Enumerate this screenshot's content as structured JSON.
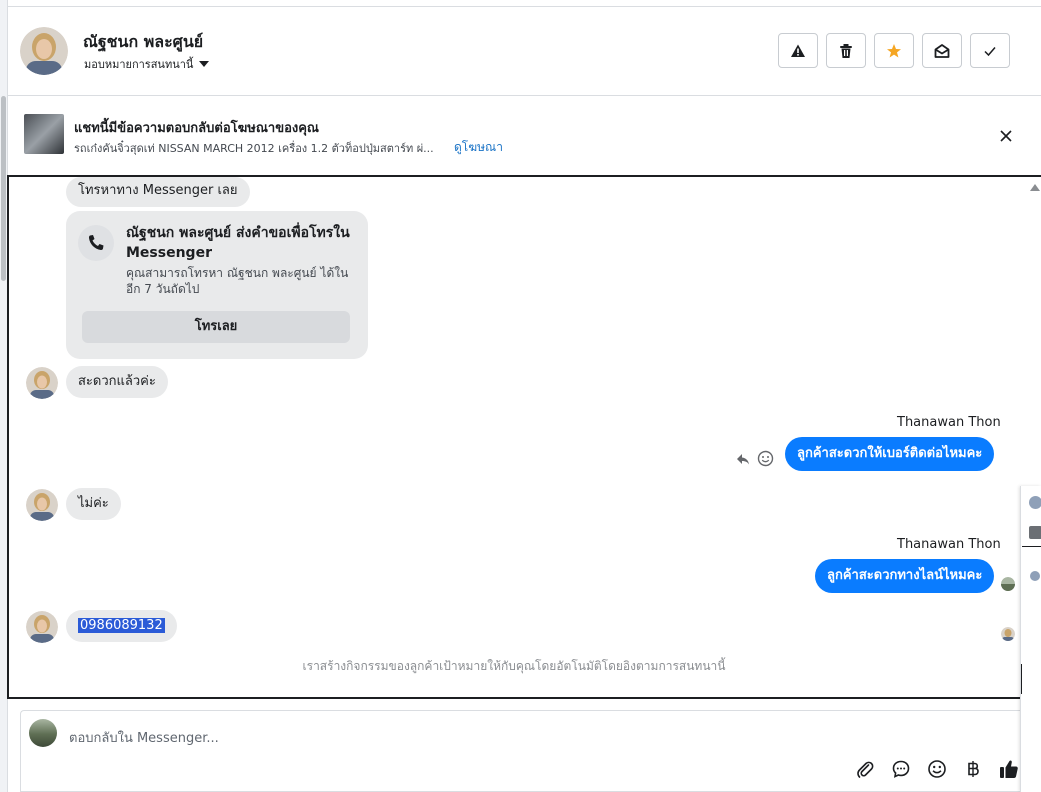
{
  "header": {
    "name": "ณัฐชนก พละศูนย์",
    "assign_label": "มอบหมายการสนทนานี้"
  },
  "actions": [
    {
      "name": "report-spam-button",
      "icon": "warning-icon"
    },
    {
      "name": "delete-button",
      "icon": "trash-icon"
    },
    {
      "name": "star-button",
      "icon": "star-icon",
      "color": "#f5a623"
    },
    {
      "name": "mark-unread-button",
      "icon": "envelope-open-icon"
    },
    {
      "name": "mark-done-button",
      "icon": "check-icon"
    }
  ],
  "ad": {
    "title": "แชทนี้มีข้อความตอบกลับต่อโฆษณาของคุณ",
    "description": "รถเก๋งคันจิ๋วสุดเท่ NISSAN MARCH 2012 เครื่อง 1.2 ตัวท็อปปุ่มสตาร์ท ผ่...",
    "link": "ดูโฆษณา"
  },
  "conversation": {
    "top_chip": "โทรหาทาง Messenger เลย",
    "call_card": {
      "title": "ณัฐชนก พละศูนย์ ส่งคำขอเพื่อโทรใน Messenger",
      "subtitle": "คุณสามารถโทรหา ณัฐชนก พละศูนย์ ได้ในอีก 7 วันถัดไป",
      "button": "โทรเลย"
    },
    "messages": [
      {
        "from": "customer",
        "text": "สะดวกแล้วค่ะ"
      },
      {
        "from": "agent",
        "sender": "Thanawan Thon",
        "text": "ลูกค้าสะดวกให้เบอร์ติดต่อไหมคะ"
      },
      {
        "from": "customer",
        "text": "ไม่ค่ะ"
      },
      {
        "from": "agent",
        "sender": "Thanawan Thon",
        "text": "ลูกค้าสะดวกทางไลน์ไหมคะ"
      },
      {
        "from": "customer",
        "text": "0986089132",
        "selected": true
      }
    ],
    "footer_note": "เราสร้างกิจกรรมของลูกค้าเป้าหมายให้กับคุณโดยอัตโนมัติโดยอิงตามการสนทนานี้"
  },
  "composer": {
    "placeholder": "ตอบกลับใน Messenger...",
    "tools": [
      "paperclip-icon",
      "chat-bubble-icon",
      "emoji-icon",
      "baht-icon",
      "thumbs-up-icon"
    ]
  },
  "colors": {
    "accent": "#0a7cff",
    "link": "#1a73c6",
    "star": "#f5a623"
  }
}
